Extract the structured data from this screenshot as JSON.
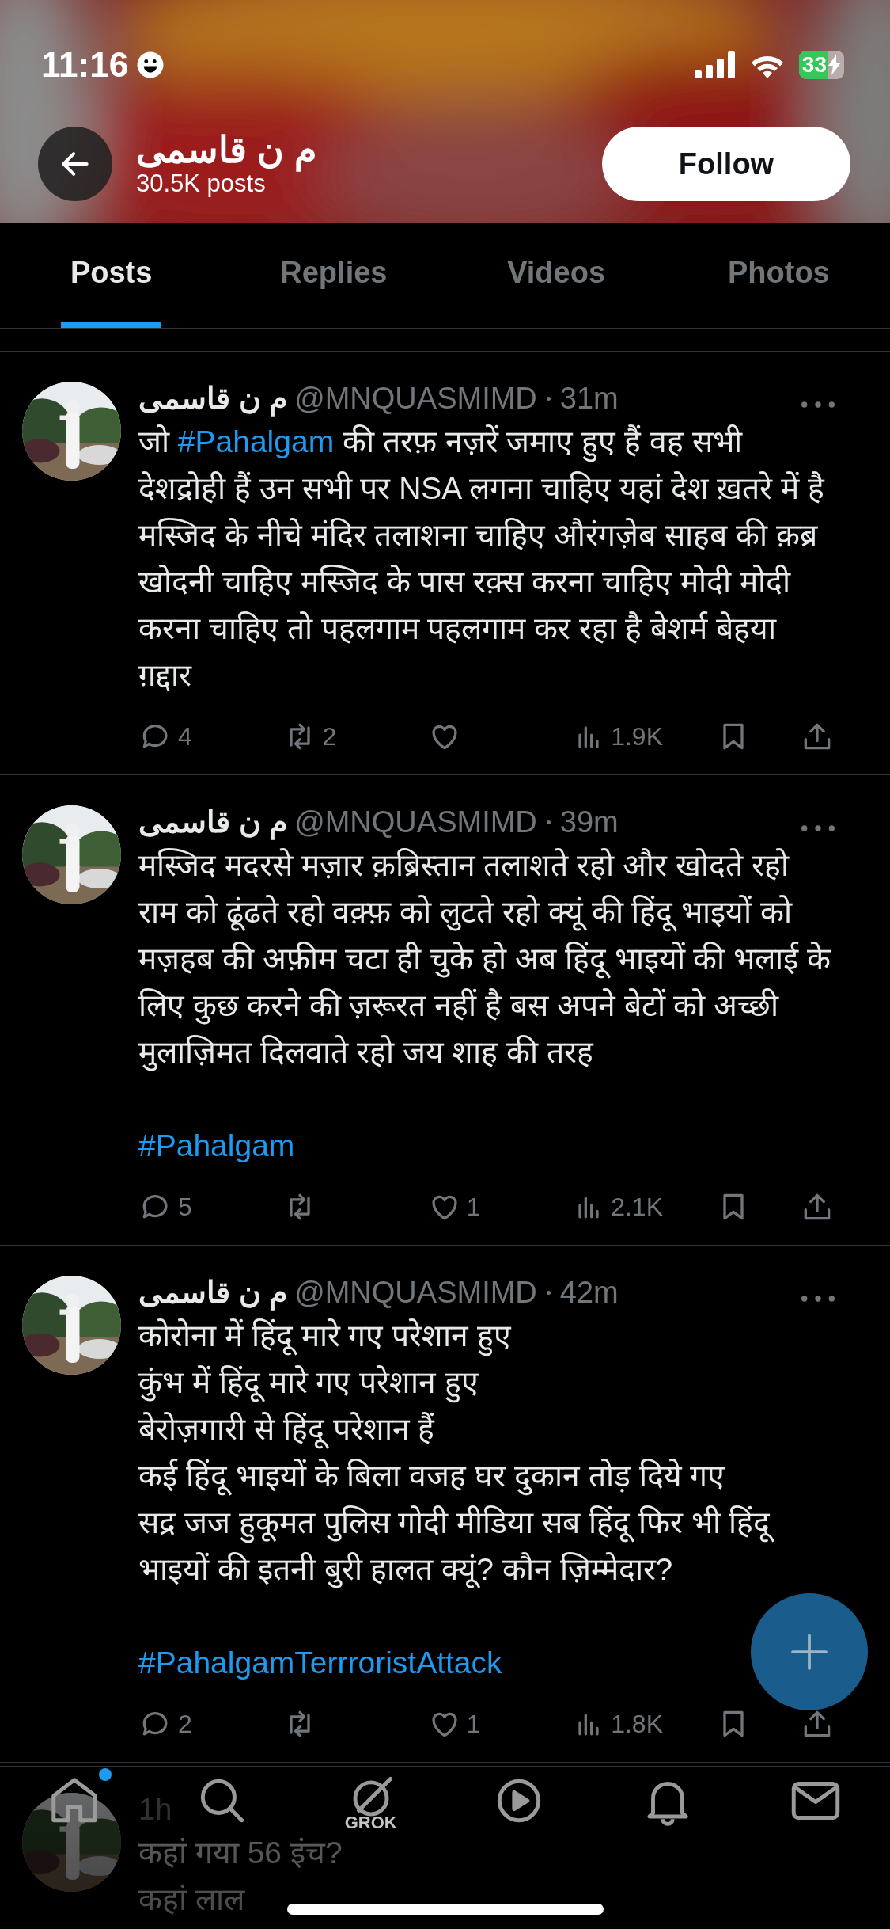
{
  "status_bar": {
    "time": "11:16",
    "battery": "33"
  },
  "header": {
    "name": "م ن قاسمی",
    "posts": "30.5K posts",
    "follow": "Follow"
  },
  "tabs": [
    {
      "label": "Posts",
      "selected": true
    },
    {
      "label": "Replies",
      "selected": false
    },
    {
      "label": "Videos",
      "selected": false
    },
    {
      "label": "Photos",
      "selected": false
    }
  ],
  "tweets": [
    {
      "name": "م ن قاسمی",
      "handle": "@MNQUASMIMD",
      "time": "31m",
      "paragraphs": [
        [
          {
            "text": "जो "
          },
          {
            "text": "#Pahalgam",
            "kind": "hashtag"
          },
          {
            "text": " की तरफ़ नज़रें जमाए हुए हैं वह सभी देशद्रोही हैं उन सभी पर NSA लगना चाहिए यहां देश ख़तरे में है मस्जिद के नीचे मंदिर तलाशना चाहिए औरंगज़ेब साहब की क़ब्र खोदनी चाहिए मस्जिद के पास रक़्स करना चाहिए मोदी मोदी करना चाहिए तो पहलगाम पहलगाम कर रहा है बेशर्म बेहया ग़द्दार"
          }
        ]
      ],
      "stats": {
        "replies": "4",
        "reposts": "2",
        "views": "1.9K"
      }
    },
    {
      "name": "م ن قاسمی",
      "handle": "@MNQUASMIMD",
      "time": "39m",
      "paragraphs": [
        [
          {
            "text": "मस्जिद मदरसे मज़ार क़ब्रिस्तान तलाशते रहो और खोदते रहो राम को ढूंढते रहो वक़्फ़ को लुटते रहो क्यूं की हिंदू भाइयों को मज़हब की अफ़ीम चटा ही चुके हो अब हिंदू भाइयों की भलाई के लिए कुछ करने की ज़रूरत नहीं है बस अपने बेटों को अच्छी मुलाज़िमत दिलवाते रहो जय शाह की तरह"
          }
        ],
        [
          {
            "text": "#Pahalgam",
            "kind": "hashtag"
          }
        ]
      ],
      "stats": {
        "replies": "5",
        "likes": "1",
        "views": "2.1K"
      }
    },
    {
      "name": "م ن قاسمی",
      "handle": "@MNQUASMIMD",
      "time": "42m",
      "paragraphs": [
        [
          {
            "text": "कोरोना में हिंदू मारे गए परेशान हुए\nकुंभ में हिंदू मारे गए परेशान हुए\nबेरोज़गारी से हिंदू परेशान हैं\nकई हिंदू भाइयों के बिला वजह घर दुकान तोड़ दिये गए\nसद्र जज हुकूमत पुलिस गोदी मीडिया सब हिंदू फिर भी हिंदू भाइयों की इतनी बुरी हालत क्यूं? कौन ज़िम्मेदार?"
          }
        ],
        [
          {
            "text": "#PahalgamTerrroristAttack",
            "kind": "hashtag"
          }
        ]
      ],
      "stats": {
        "replies": "2",
        "likes": "1",
        "views": "1.8K"
      }
    },
    {
      "time": "1h",
      "lines": [
        "कहां गया 56 इंच?",
        "कहां लाल"
      ]
    }
  ],
  "nav": [
    {
      "kind": "home",
      "dot": true
    },
    {
      "kind": "search"
    },
    {
      "kind": "grok",
      "label": "GROK"
    },
    {
      "kind": "video"
    },
    {
      "kind": "bell"
    },
    {
      "kind": "mail"
    }
  ]
}
